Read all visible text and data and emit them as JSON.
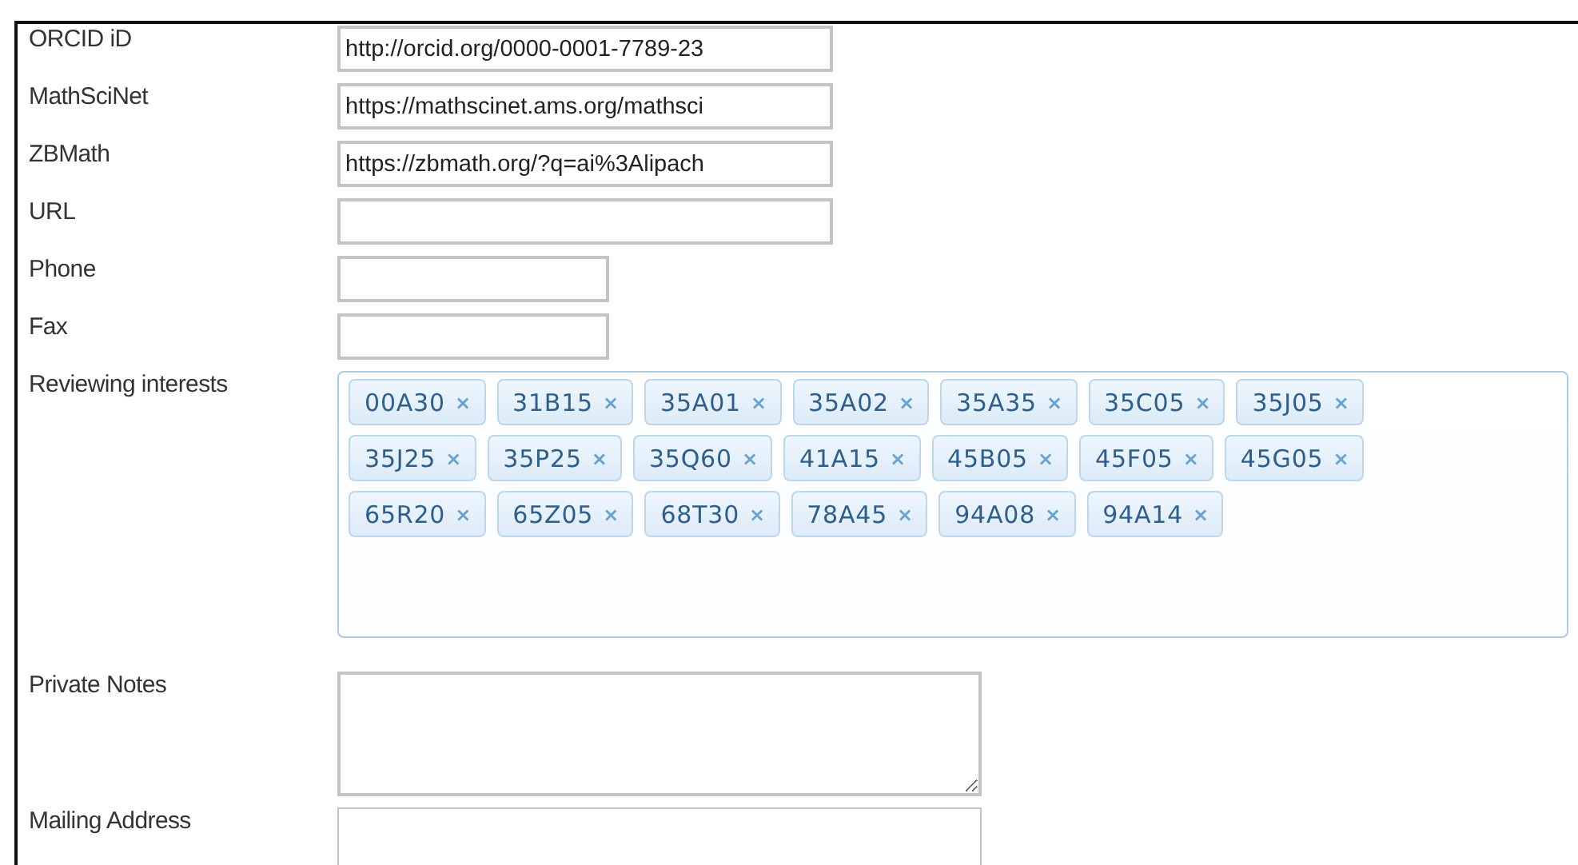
{
  "fields": [
    {
      "label": "ORCID iD",
      "kind": "text",
      "value": "http://orcid.org/0000-0001-7789-23"
    },
    {
      "label": "MathSciNet",
      "kind": "text",
      "value": "https://mathscinet.ams.org/mathsci"
    },
    {
      "label": "ZBMath",
      "kind": "text",
      "value": "https://zbmath.org/?q=ai%3Alipach"
    },
    {
      "label": "URL",
      "kind": "text"
    },
    {
      "label": "Phone",
      "kind": "text_short"
    },
    {
      "label": "Fax",
      "kind": "text_short"
    },
    {
      "label": "Reviewing interests",
      "kind": "tags",
      "tags": [
        "00A30",
        "31B15",
        "35A01",
        "35A02",
        "35A35",
        "35C05",
        "35J05",
        "35J25",
        "35P25",
        "35Q60",
        "41A15",
        "45B05",
        "45F05",
        "45G05",
        "65R20",
        "65Z05",
        "68T30",
        "78A45",
        "94A08",
        "94A14"
      ],
      "remove": "×"
    },
    {
      "label": "Private Notes",
      "kind": "textarea"
    },
    {
      "label": "Mailing Address",
      "kind": "textarea_cut"
    }
  ]
}
